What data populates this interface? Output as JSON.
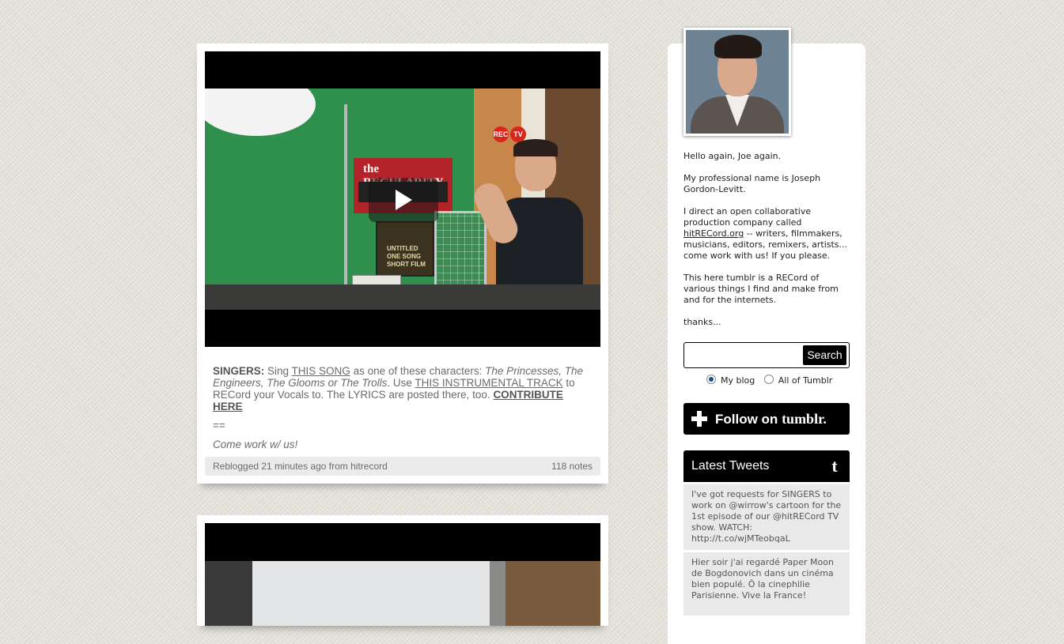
{
  "post1": {
    "video": {
      "rec_label": "REC",
      "rec_tv": "TV",
      "sign_title": "the REGULARITY",
      "poster_text": "UNTITLED ONE SONG SHORT FILM"
    },
    "caption": {
      "lead": "SINGERS:",
      "t1": " Sing ",
      "link_song": "THIS SONG",
      "t2": " as one of these characters: ",
      "characters": "The Princesses, The Engineers, The Glooms or The Trolls",
      "t3": ". Use ",
      "link_track": "THIS INSTRUMENTAL TRACK",
      "t4": " to RECord your Vocals to. The LYRICS are posted there, too. ",
      "link_contribute": "CONTRIBUTE HERE",
      "divider": "==",
      "closing": "Come work w/ us!"
    },
    "meta": {
      "reblogged": "Reblogged 21 minutes ago from hitrecord",
      "notes": "118 notes"
    }
  },
  "sidebar": {
    "bio": {
      "p1": "Hello again, Joe again.",
      "p2": "My professional name is Joseph Gordon-Levitt.",
      "p3a": "I direct an open collaborative production company called ",
      "p3_link": "hitRECord.org",
      "p3b": " -- writers, filmmakers, musicians, editors, remixers, artists... come work with us! If you please.",
      "p4": "This here tumblr is a RECord of various things I find and make from and for the internets.",
      "p5": "thanks..."
    },
    "search": {
      "value": "",
      "placeholder": "",
      "button_label": "Search",
      "option_my_blog": "My blog",
      "option_all": "All of Tumblr"
    },
    "follow": {
      "text": "Follow on",
      "brand": "tumblr."
    },
    "tweets": {
      "title": "Latest Tweets",
      "items": [
        "I've got requests for SINGERS to work on @wirrow's cartoon for the 1st episode of our @hitRECord TV show. WATCH: http://t.co/wjMTeobqaL",
        "Hier soir j'ai regardé Paper Moon de Bogdonovich dans un cinéma bien populé. Ô la cinephilie Parisienne. Vive la France!"
      ]
    }
  }
}
